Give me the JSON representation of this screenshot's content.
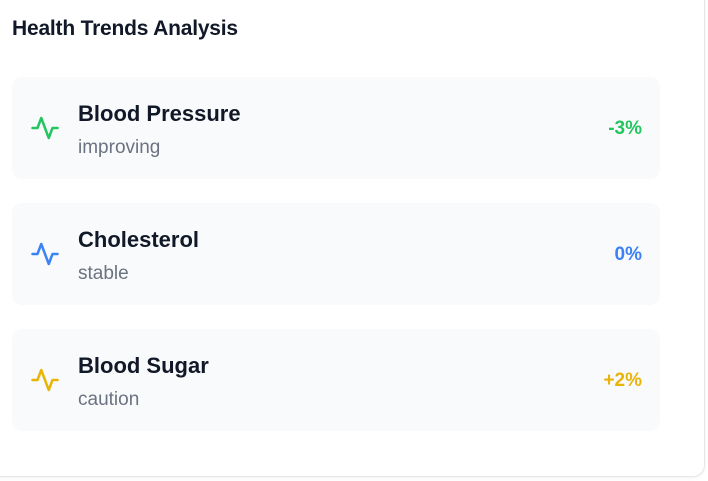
{
  "panel": {
    "title": "Health Trends Analysis"
  },
  "trends": [
    {
      "name": "Blood Pressure",
      "status": "improving",
      "change": "-3%",
      "color": "#22c55e",
      "icon": "activity-icon"
    },
    {
      "name": "Cholesterol",
      "status": "stable",
      "change": "0%",
      "color": "#3b82f6",
      "icon": "activity-icon"
    },
    {
      "name": "Blood Sugar",
      "status": "caution",
      "change": "+2%",
      "color": "#eab308",
      "icon": "activity-icon"
    }
  ]
}
